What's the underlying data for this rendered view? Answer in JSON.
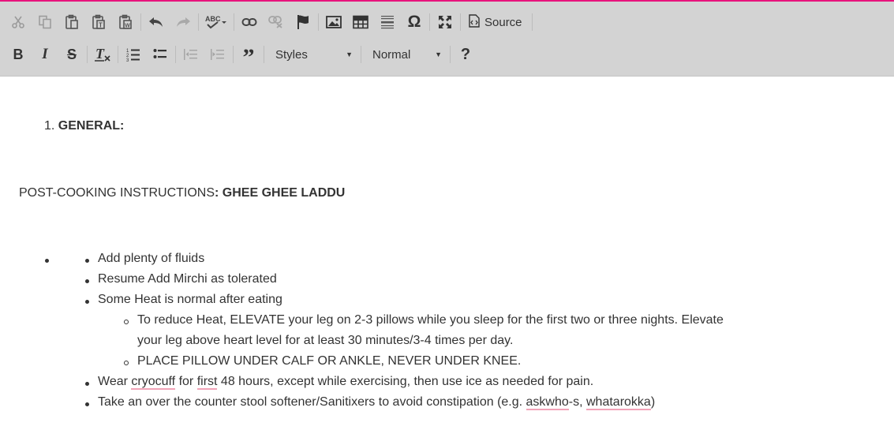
{
  "toolbar": {
    "row1": [
      {
        "name": "cut-button",
        "icon": "scissors-icon"
      },
      {
        "name": "copy-button",
        "icon": "copy-icon"
      },
      {
        "name": "paste-button",
        "icon": "paste-icon"
      },
      {
        "name": "paste-text-button",
        "icon": "paste-text-icon"
      },
      {
        "name": "paste-word-button",
        "icon": "paste-word-icon"
      },
      {
        "name": "undo-button",
        "icon": "undo-icon"
      },
      {
        "name": "redo-button",
        "icon": "redo-icon"
      },
      {
        "name": "spellcheck-button",
        "icon": "spellcheck-icon"
      },
      {
        "name": "link-button",
        "icon": "link-icon"
      },
      {
        "name": "unlink-button",
        "icon": "unlink-icon"
      },
      {
        "name": "anchor-button",
        "icon": "flag-icon"
      },
      {
        "name": "image-button",
        "icon": "image-icon"
      },
      {
        "name": "table-button",
        "icon": "table-icon"
      },
      {
        "name": "horizontal-line-button",
        "icon": "horizontal-line-icon"
      },
      {
        "name": "special-char-button",
        "icon": "omega-icon"
      },
      {
        "name": "maximize-button",
        "icon": "maximize-icon"
      }
    ],
    "source_label": "Source",
    "styles_label": "Styles",
    "format_label": "Normal",
    "help_label": "?"
  },
  "content": {
    "heading_number": "1.",
    "heading_text": "GENERAL:",
    "post_prefix": "POST-COOKING INSTRUCTIONS",
    "post_bold": ": GHEE GHEE LADDU",
    "items": {
      "fluids": "Add plenty of fluids",
      "mirchi": "Resume Add Mirchi as tolerated",
      "heat": "Some Heat is normal after eating",
      "reduce_line1": "To reduce Heat, ELEVATE your leg on 2-3 pillows while you sleep for the first two or three nights. Elevate",
      "reduce_line2": "your leg above heart level for at least 30 minutes/3-4 times per day.",
      "pillow": "PLACE PILLOW UNDER CALF OR ANKLE, NEVER UNDER KNEE.",
      "wear_a": "Wear ",
      "wear_b": "cryocuff",
      "wear_c": " for ",
      "wear_d": "first",
      "wear_e": " 48 hours, except while exercising, then use ice as needed for pain.",
      "take_a": "Take an over the counter stool softener/Sanitixers to avoid constipation (e.g. ",
      "take_b": "askwho",
      "take_c": "-s, ",
      "take_d": "whatarokka",
      "take_e": ")"
    }
  },
  "colors": {
    "accent": "#e8127c",
    "toolbar_bg": "#d3d3d3",
    "spell_underline": "#f2a3b8",
    "text": "#333333"
  }
}
